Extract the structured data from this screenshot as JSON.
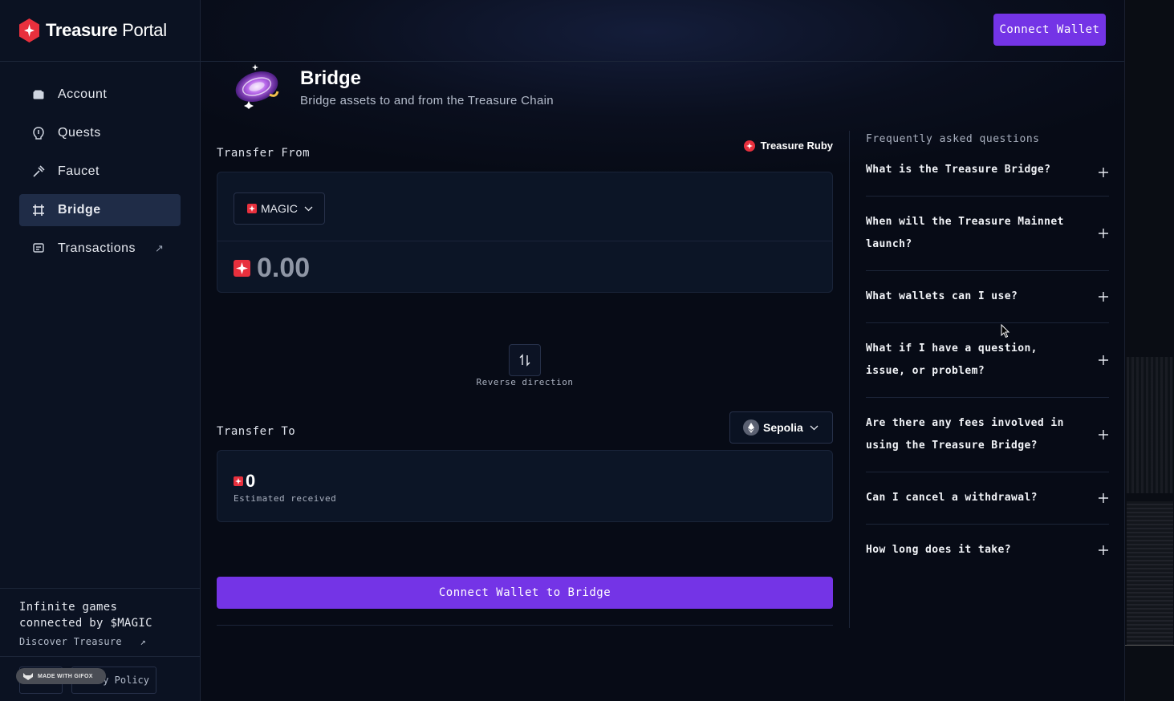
{
  "brand": {
    "bold": "Treasure",
    "light": "Portal"
  },
  "header": {
    "connect_label": "Connect Wallet"
  },
  "sidebar": {
    "items": [
      {
        "label": "Account",
        "icon": "wallet-icon"
      },
      {
        "label": "Quests",
        "icon": "quest-icon"
      },
      {
        "label": "Faucet",
        "icon": "faucet-icon"
      },
      {
        "label": "Bridge",
        "icon": "bridge-icon",
        "active": true
      },
      {
        "label": "Transactions",
        "icon": "receipt-icon",
        "external": "↗"
      }
    ],
    "promo": {
      "line1": "Infinite games",
      "line2": "connected by $MAGIC",
      "link": "Discover Treasure",
      "link_icon": "↗"
    },
    "footer_link": "cy Policy",
    "watermark": "MADE WITH GIFOX"
  },
  "page": {
    "title": "Bridge",
    "subtitle": "Bridge assets to and from the Treasure Chain"
  },
  "transfer_from": {
    "label": "Transfer From",
    "chain": "Treasure Ruby",
    "token": "MAGIC",
    "amount": "0.00"
  },
  "reverse": {
    "label": "Reverse direction"
  },
  "transfer_to": {
    "label": "Transfer To",
    "chain": "Sepolia",
    "amount": "0",
    "amount_caption": "Estimated received"
  },
  "bridge_button": "Connect Wallet to Bridge",
  "faq": {
    "title": "Frequently asked questions",
    "items": [
      "What is the Treasure Bridge?",
      "When will the Treasure Mainnet launch?",
      "What wallets can I use?",
      "What if I have a question, issue, or problem?",
      "Are there any fees involved in using the Treasure Bridge?",
      "Can I cancel a withdrawal?",
      "How long does it take?"
    ]
  },
  "colors": {
    "accent": "#7434e6",
    "treasure_red": "#e8303d",
    "background": "#070b16"
  }
}
